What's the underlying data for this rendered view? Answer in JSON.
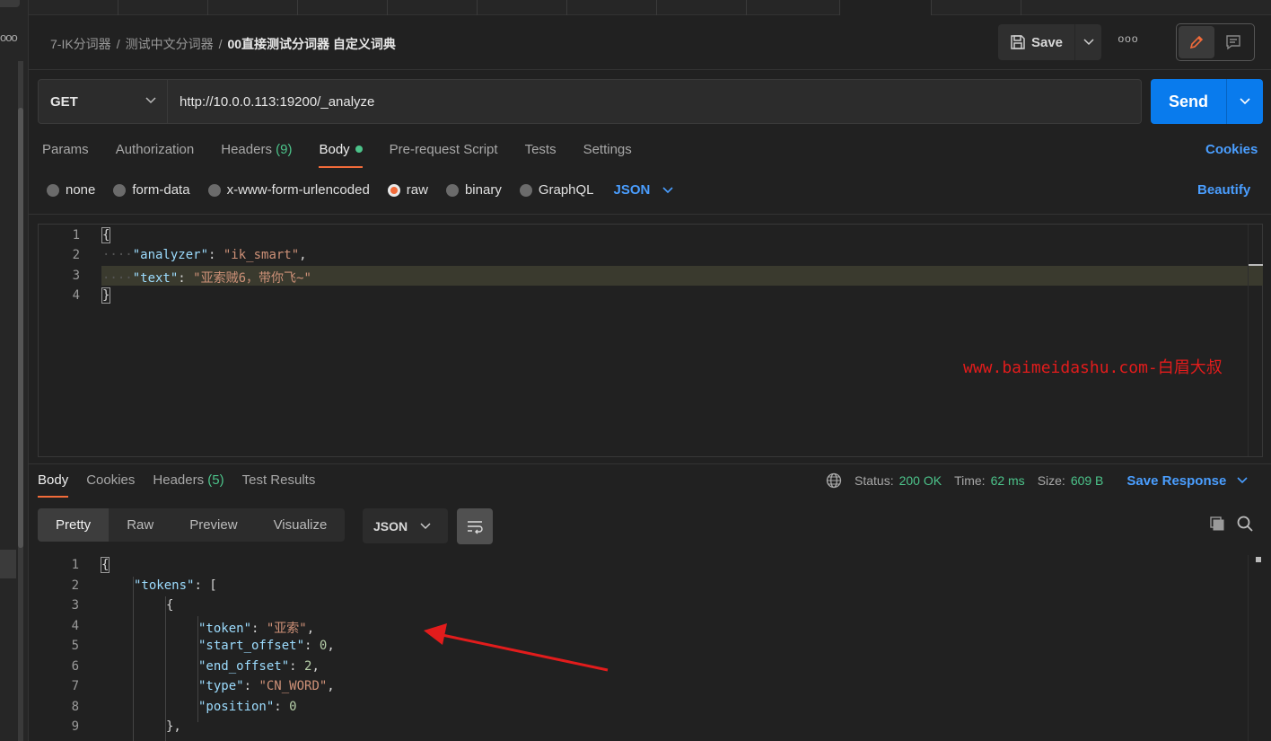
{
  "breadcrumb": {
    "items": [
      "7-IK分词器",
      "测试中文分词器"
    ],
    "current": "00直接测试分词器 自定义词典",
    "separator": "/"
  },
  "toolbar": {
    "save_label": "Save",
    "more_label": "ooo"
  },
  "request": {
    "method": "GET",
    "url": "http://10.0.0.113:19200/_analyze",
    "send_label": "Send"
  },
  "request_tabs": {
    "params": "Params",
    "authorization": "Authorization",
    "headers": "Headers",
    "headers_count": "(9)",
    "body": "Body",
    "pre_request": "Pre-request Script",
    "tests": "Tests",
    "settings": "Settings",
    "cookies": "Cookies"
  },
  "body_types": {
    "none": "none",
    "form_data": "form-data",
    "urlencoded": "x-www-form-urlencoded",
    "raw": "raw",
    "binary": "binary",
    "graphql": "GraphQL",
    "format": "JSON",
    "beautify": "Beautify"
  },
  "request_body": {
    "line_numbers": [
      "1",
      "2",
      "3",
      "4"
    ],
    "open": "{",
    "close": "}",
    "k1": "\"analyzer\"",
    "v1": "\"ik_smart\"",
    "k2": "\"text\"",
    "v2": "\"亚索贼6，带你飞~\"",
    "ws": "····"
  },
  "watermark": "www.baimeidashu.com-白眉大叔",
  "response_tabs": {
    "body": "Body",
    "cookies": "Cookies",
    "headers": "Headers",
    "headers_count": "(5)",
    "test_results": "Test Results"
  },
  "response_status": {
    "status_label": "Status:",
    "status_value": "200 OK",
    "time_label": "Time:",
    "time_value": "62 ms",
    "size_label": "Size:",
    "size_value": "609 B",
    "save_response": "Save Response"
  },
  "response_view": {
    "pretty": "Pretty",
    "raw": "Raw",
    "preview": "Preview",
    "visualize": "Visualize",
    "format": "JSON"
  },
  "response_body": {
    "line_numbers": [
      "1",
      "2",
      "3",
      "4",
      "5",
      "6",
      "7",
      "8",
      "9"
    ],
    "open": "{",
    "tokens_key": "\"tokens\"",
    "arr_open": "[",
    "obj_open": "{",
    "token_key": "\"token\"",
    "token_val": "\"亚索\"",
    "start_key": "\"start_offset\"",
    "start_val": "0",
    "end_key": "\"end_offset\"",
    "end_val": "2",
    "type_key": "\"type\"",
    "type_val": "\"CN_WORD\"",
    "pos_key": "\"position\"",
    "pos_val": "0",
    "obj_close": "},"
  },
  "colors": {
    "accent_orange": "#f26b3a",
    "send_blue": "#097bed",
    "link_blue": "#4a9eff",
    "success_green": "#4cc38a",
    "annotation_red": "#e21c1c"
  }
}
